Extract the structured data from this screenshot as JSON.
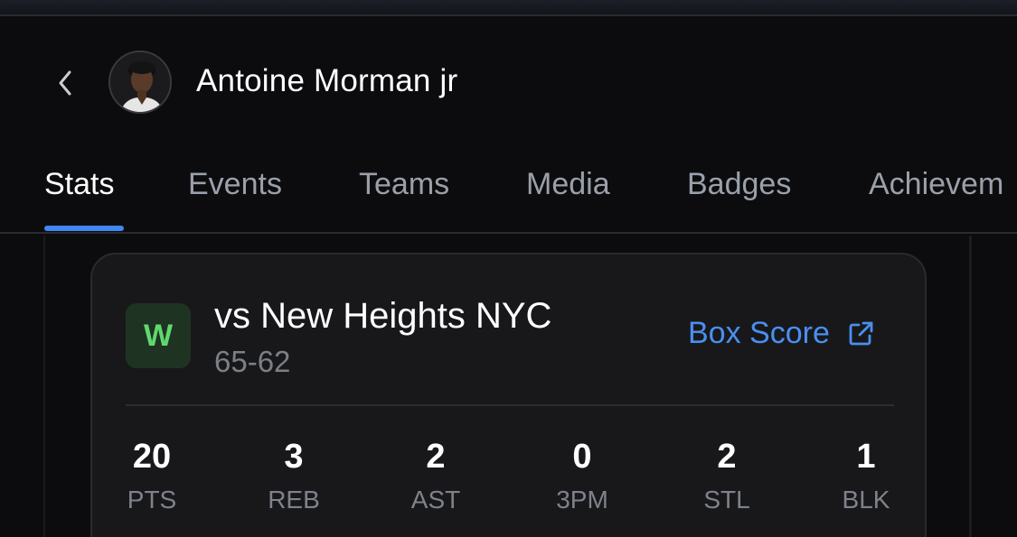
{
  "player": {
    "name": "Antoine Morman jr"
  },
  "tabs": [
    {
      "label": "Stats",
      "active": true
    },
    {
      "label": "Events",
      "active": false
    },
    {
      "label": "Teams",
      "active": false
    },
    {
      "label": "Media",
      "active": false
    },
    {
      "label": "Badges",
      "active": false
    },
    {
      "label": "Achievem",
      "active": false
    }
  ],
  "game": {
    "result": "W",
    "opponent": "vs New Heights NYC",
    "score": "65-62",
    "box_score_label": "Box Score"
  },
  "stats": [
    {
      "value": "20",
      "label": "PTS"
    },
    {
      "value": "3",
      "label": "REB"
    },
    {
      "value": "2",
      "label": "AST"
    },
    {
      "value": "0",
      "label": "3PM"
    },
    {
      "value": "2",
      "label": "STL"
    },
    {
      "value": "1",
      "label": "BLK"
    }
  ],
  "colors": {
    "accent": "#3f86f0",
    "link": "#4a8fef",
    "win_green": "#5fd96f",
    "background": "#0c0c0e",
    "card": "#18181b"
  },
  "icons": {
    "back": "chevron-left-icon",
    "external_link": "external-link-icon"
  }
}
